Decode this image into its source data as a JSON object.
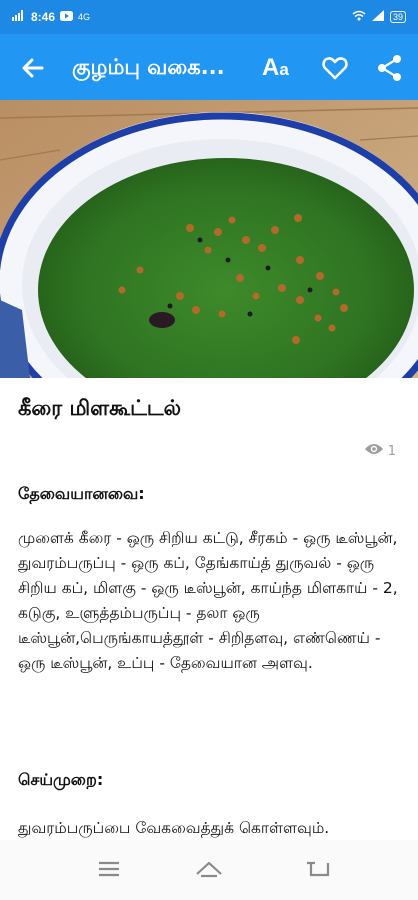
{
  "status_bar": {
    "left_indicators": "Vo LTE",
    "time": "8:46",
    "network": "4G",
    "battery_level": "39"
  },
  "app_bar": {
    "title": "குழம்பு வகை...",
    "font_size_label": "A",
    "font_size_label_small": "a"
  },
  "recipe": {
    "title": "கீரை மிளகூட்டல்",
    "view_count": "1",
    "ingredients_heading": "தேவையானவை:",
    "ingredients_text": " முளைக் கீரை - ஒரு சிறிய கட்டு, சீரகம் - ஒரு டீஸ்பூன், துவரம்பருப்பு - ஒரு கப், தேங்காய்த் துருவல் - ஒரு சிறிய கப், மிளகு - ஒரு டீஸ்பூன், காய்ந்த மிளகாய் - 2, கடுகு, உளுத்தம்பருப்பு - தலா ஒரு டீஸ்பூன்,பெருங்காயத்தூள் - சிறிதளவு, எண்ணெய் - ஒரு டீஸ்பூன், உப்பு - தேவையான அளவு.",
    "method_heading": "செய்முறை:",
    "method_text": "துவரம்பருப்பை வேகவைத்துக் கொள்ளவும்."
  },
  "colors": {
    "status_bar": "#1e88e5",
    "app_bar": "#2196f3",
    "app_bar_text": "#ffffff"
  },
  "icons": [
    "back-arrow-icon",
    "font-size-icon",
    "heart-icon",
    "share-icon",
    "eye-icon",
    "menu-icon",
    "home-icon",
    "back-nav-icon"
  ]
}
